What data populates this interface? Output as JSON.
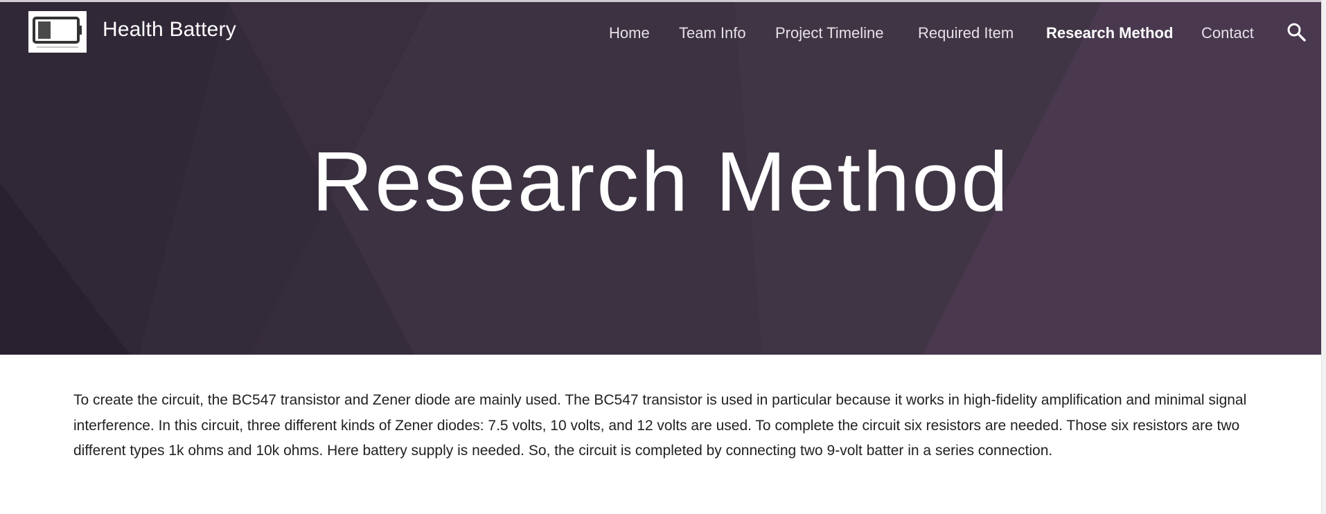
{
  "site": {
    "title": "Health Battery",
    "logo_icon": "battery-logo-icon"
  },
  "nav": {
    "items": [
      {
        "label": "Home",
        "active": false
      },
      {
        "label": "Team Info",
        "active": false
      },
      {
        "label": "Project Timeline",
        "active": false
      },
      {
        "label": "Required Item",
        "active": false
      },
      {
        "label": "Research Method",
        "active": true
      },
      {
        "label": "Contact",
        "active": false
      }
    ],
    "search_icon": "search-icon"
  },
  "hero": {
    "title": "Research Method",
    "background_color": "#3f3345"
  },
  "content": {
    "paragraph": "To create the circuit, the BC547 transistor and Zener diode are mainly used. The BC547 transistor is used in particular because it works in high-fidelity amplification and minimal signal interference. In this circuit, three different kinds of Zener diodes: 7.5 volts, 10 volts, and 12 volts are used. To complete the circuit six resistors are needed. Those six resistors are two different types 1k ohms and 10k ohms. Here battery supply is needed. So, the circuit is completed by connecting two 9-volt batter in a series connection."
  }
}
